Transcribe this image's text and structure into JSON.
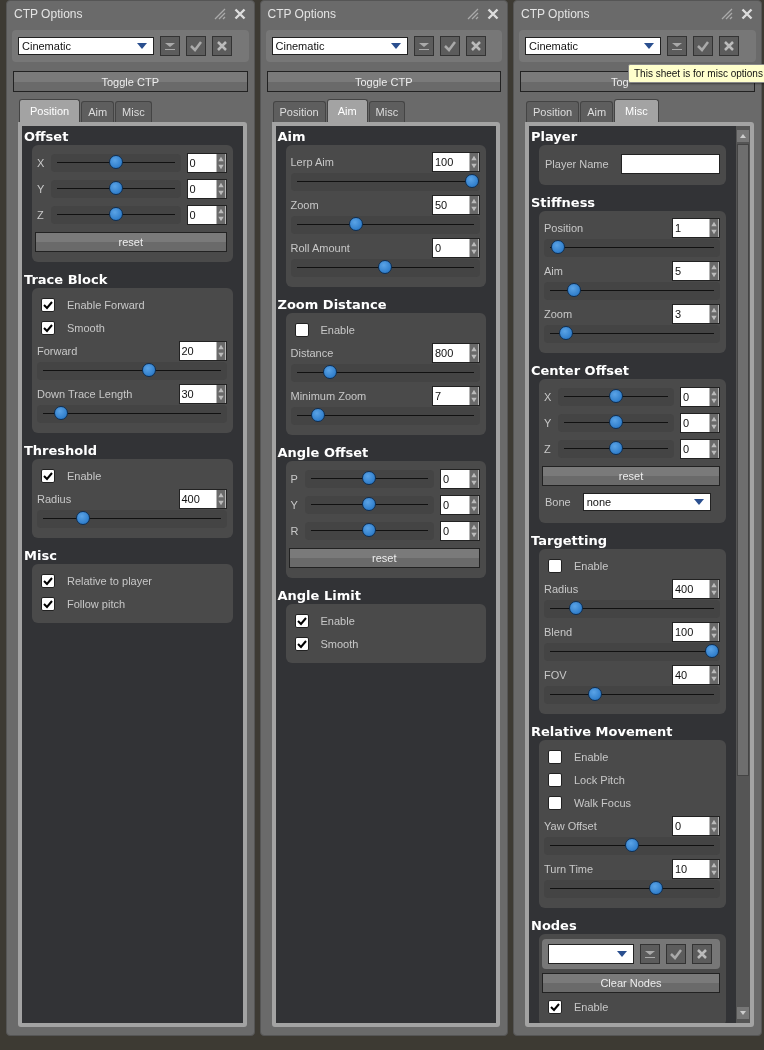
{
  "windows": [
    {
      "title": "CTP Options",
      "preset": "Cinematic",
      "toggle": "Toggle CTP",
      "tabs": [
        {
          "label": "Position",
          "selected": true
        },
        {
          "label": "Aim",
          "selected": false
        },
        {
          "label": "Misc",
          "selected": false
        }
      ],
      "scrollbar": false,
      "sections": [
        {
          "heading": "Offset",
          "rows": [
            {
              "kind": "axis",
              "label": "X",
              "value": "0",
              "level": 0.5
            },
            {
              "kind": "axis",
              "label": "Y",
              "value": "0",
              "level": 0.5
            },
            {
              "kind": "axis",
              "label": "Z",
              "value": "0",
              "level": 0.5
            },
            {
              "kind": "button",
              "label": "reset"
            }
          ]
        },
        {
          "heading": "Trace Block",
          "rows": [
            {
              "kind": "check",
              "label": "Enable Forward",
              "checked": true
            },
            {
              "kind": "check",
              "label": "Smooth",
              "checked": true
            },
            {
              "kind": "slider",
              "label": "Forward",
              "value": "20",
              "level": 0.6
            },
            {
              "kind": "slider",
              "label": "Down Trace Length",
              "value": "30",
              "level": 0.09
            }
          ]
        },
        {
          "heading": "Threshold",
          "rows": [
            {
              "kind": "check",
              "label": "Enable",
              "checked": true
            },
            {
              "kind": "slider",
              "label": "Radius",
              "value": "400",
              "level": 0.22
            }
          ]
        },
        {
          "heading": "Misc",
          "rows": [
            {
              "kind": "check",
              "label": "Relative to player",
              "checked": true
            },
            {
              "kind": "check",
              "label": "Follow pitch",
              "checked": true
            }
          ]
        }
      ]
    },
    {
      "title": "CTP Options",
      "preset": "Cinematic",
      "toggle": "Toggle CTP",
      "tabs": [
        {
          "label": "Position",
          "selected": false
        },
        {
          "label": "Aim",
          "selected": true
        },
        {
          "label": "Misc",
          "selected": false
        }
      ],
      "scrollbar": false,
      "sections": [
        {
          "heading": "Aim",
          "rows": [
            {
              "kind": "slider",
              "label": "Lerp Aim",
              "value": "100",
              "level": 1
            },
            {
              "kind": "slider",
              "label": "Zoom",
              "value": "50",
              "level": 0.33
            },
            {
              "kind": "slider",
              "label": "Roll Amount",
              "value": "0",
              "level": 0.5
            }
          ]
        },
        {
          "heading": "Zoom Distance",
          "rows": [
            {
              "kind": "check",
              "label": "Enable",
              "checked": false
            },
            {
              "kind": "slider",
              "label": "Distance",
              "value": "800",
              "level": 0.18
            },
            {
              "kind": "slider",
              "label": "Minimum Zoom",
              "value": "7",
              "level": 0.11
            }
          ]
        },
        {
          "heading": "Angle Offset",
          "rows": [
            {
              "kind": "axis",
              "label": "P",
              "value": "0",
              "level": 0.5
            },
            {
              "kind": "axis",
              "label": "Y",
              "value": "0",
              "level": 0.5
            },
            {
              "kind": "axis",
              "label": "R",
              "value": "0",
              "level": 0.5
            },
            {
              "kind": "button",
              "label": "reset"
            }
          ]
        },
        {
          "heading": "Angle Limit",
          "rows": [
            {
              "kind": "check",
              "label": "Enable",
              "checked": true
            },
            {
              "kind": "check",
              "label": "Smooth",
              "checked": true
            }
          ]
        }
      ]
    },
    {
      "title": "CTP Options",
      "preset": "Cinematic",
      "toggle": "Tog",
      "tooltip": "This sheet is for misc options",
      "tabs": [
        {
          "label": "Position",
          "selected": false
        },
        {
          "label": "Aim",
          "selected": false
        },
        {
          "label": "Misc",
          "selected": true
        }
      ],
      "scrollbar": true,
      "sections": [
        {
          "heading": "Player",
          "rows": [
            {
              "kind": "text",
              "label": "Player Name"
            }
          ]
        },
        {
          "heading": "Stiffness",
          "rows": [
            {
              "kind": "slider",
              "label": "Position",
              "value": "1",
              "level": 0.04
            },
            {
              "kind": "slider",
              "label": "Aim",
              "value": "5",
              "level": 0.14
            },
            {
              "kind": "slider",
              "label": "Zoom",
              "value": "3",
              "level": 0.09
            }
          ]
        },
        {
          "heading": "Center Offset",
          "rows": [
            {
              "kind": "axis",
              "label": "X",
              "value": "0",
              "level": 0.5
            },
            {
              "kind": "axis",
              "label": "Y",
              "value": "0",
              "level": 0.5
            },
            {
              "kind": "axis",
              "label": "Z",
              "value": "0",
              "level": 0.5
            },
            {
              "kind": "button",
              "label": "reset"
            },
            {
              "kind": "combo",
              "label": "Bone",
              "value": "none"
            }
          ]
        },
        {
          "heading": "Targetting",
          "rows": [
            {
              "kind": "check",
              "label": "Enable",
              "checked": false
            },
            {
              "kind": "slider",
              "label": "Radius",
              "value": "400",
              "level": 0.15
            },
            {
              "kind": "slider",
              "label": "Blend",
              "value": "100",
              "level": 1
            },
            {
              "kind": "slider",
              "label": "FOV",
              "value": "40",
              "level": 0.27
            }
          ]
        },
        {
          "heading": "Relative Movement",
          "rows": [
            {
              "kind": "check",
              "label": "Enable",
              "checked": false
            },
            {
              "kind": "check",
              "label": "Lock Pitch",
              "checked": false
            },
            {
              "kind": "check",
              "label": "Walk Focus",
              "checked": false
            },
            {
              "kind": "slider",
              "label": "Yaw Offset",
              "value": "0",
              "level": 0.5
            },
            {
              "kind": "slider",
              "label": "Turn Time",
              "value": "10",
              "level": 0.65
            }
          ]
        },
        {
          "heading": "Nodes",
          "rows": [
            {
              "kind": "presetbar"
            },
            {
              "kind": "button",
              "label": "Clear Nodes"
            },
            {
              "kind": "check",
              "label": "Enable",
              "checked": true
            }
          ]
        }
      ]
    }
  ]
}
